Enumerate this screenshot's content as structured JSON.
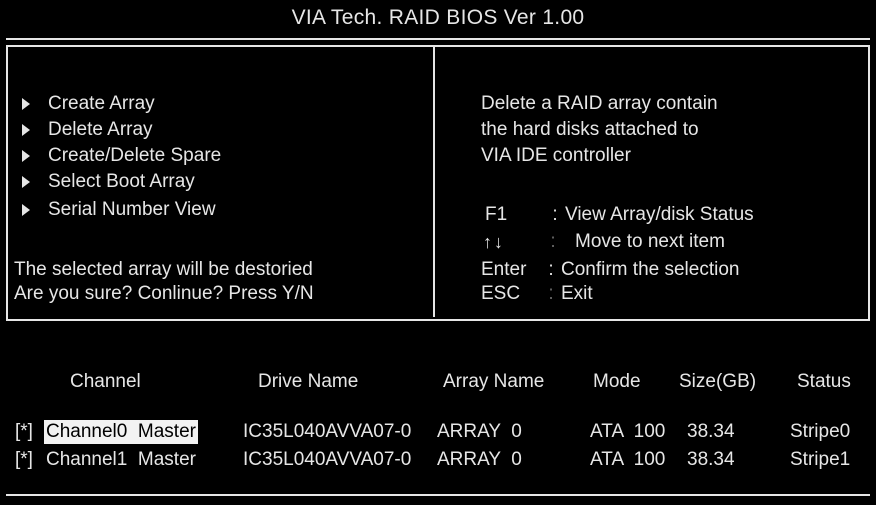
{
  "title": "VIA Tech.  RAID BIOS Ver  1.00",
  "menu": {
    "items": [
      {
        "label": "Create Array"
      },
      {
        "label": "Delete Array"
      },
      {
        "label": "Create/Delete Spare"
      },
      {
        "label": "Select Boot Array"
      },
      {
        "label": "Serial Number View"
      }
    ]
  },
  "warning": {
    "line1": "The selected array will be destoried",
    "line2": "Are you sure? Conlinue? Press Y/N"
  },
  "help": {
    "description": [
      "Delete a RAID array contain",
      "the hard disks attached to",
      "VIA IDE controller"
    ],
    "keys": [
      {
        "key": "F1",
        "sep": ":",
        "desc": "View Array/disk Status"
      },
      {
        "key": "↑↓",
        "sep": ":",
        "desc": "Move to next item"
      },
      {
        "key": "Enter",
        "sep": ":",
        "desc": "Confirm the selection"
      },
      {
        "key": "ESC",
        "sep": ":",
        "desc": "Exit"
      }
    ]
  },
  "table": {
    "headers": {
      "channel": "Channel",
      "drive_name": "Drive Name",
      "array_name": "Array Name",
      "mode": "Mode",
      "size": "Size(GB)",
      "status": "Status"
    },
    "rows": [
      {
        "marker": "[*]",
        "channel": "Channel0  Master",
        "drive_name": "IC35L040AVVA07-0",
        "array_name": "ARRAY  0",
        "mode": "ATA  100",
        "size": "38.34",
        "status": "Stripe0"
      },
      {
        "marker": "[*]",
        "channel": "Channel1  Master",
        "drive_name": "IC35L040AVVA07-0",
        "array_name": "ARRAY  0",
        "mode": "ATA  100",
        "size": "38.34",
        "status": "Stripe1"
      }
    ]
  },
  "colors": {
    "background": "#000000",
    "foreground": "#e6e6e6",
    "highlight_bg": "#f2f2f2",
    "highlight_fg": "#000000"
  }
}
